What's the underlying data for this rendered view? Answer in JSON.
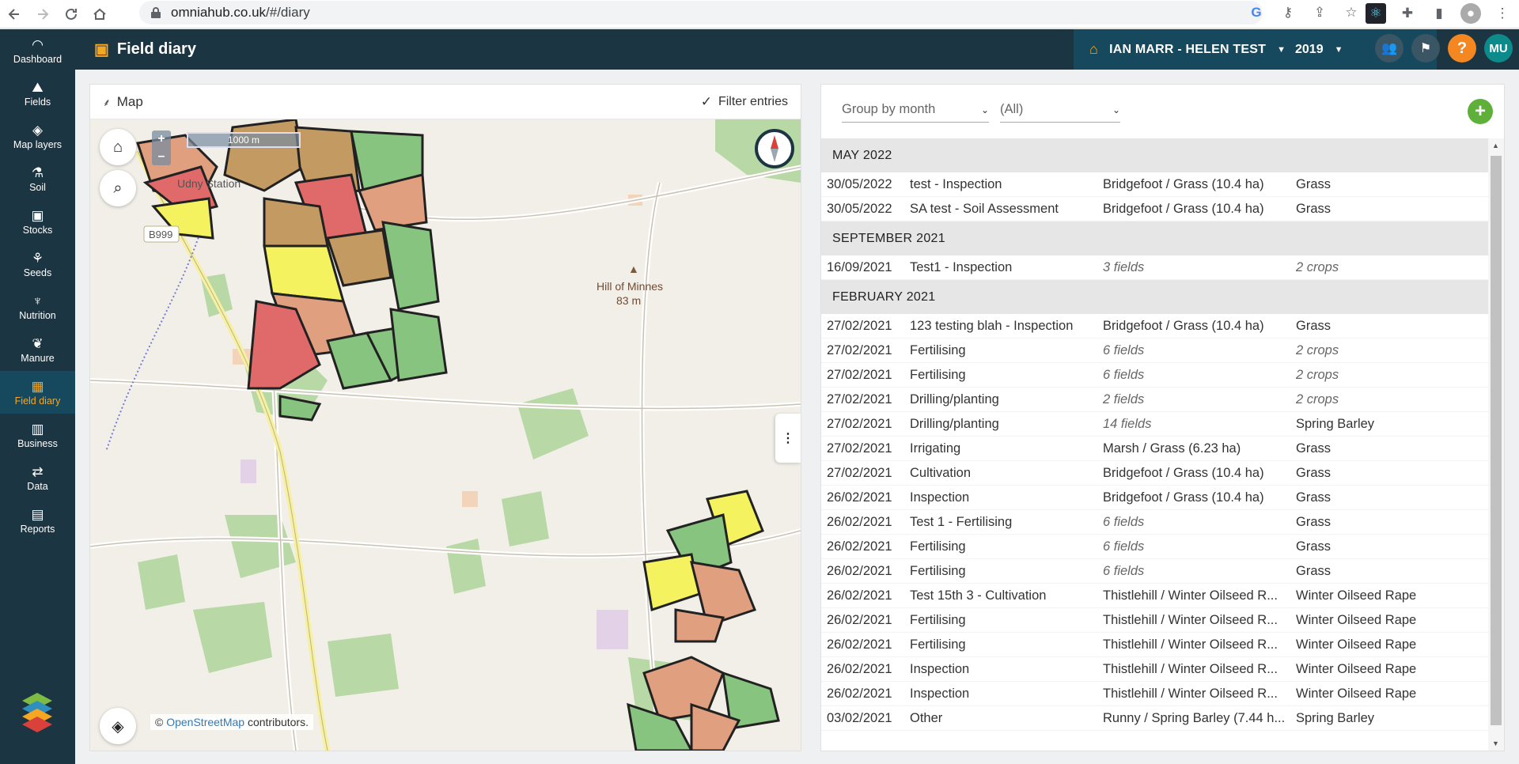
{
  "browser": {
    "url_host": "omniahub.co.uk",
    "url_path": "/#/diary"
  },
  "sidebar": {
    "items": [
      {
        "label": "Dashboard",
        "icon": "dashboard-icon"
      },
      {
        "label": "Fields",
        "icon": "fields-icon"
      },
      {
        "label": "Map layers",
        "icon": "layers-icon"
      },
      {
        "label": "Soil",
        "icon": "soil-icon"
      },
      {
        "label": "Stocks",
        "icon": "stocks-icon"
      },
      {
        "label": "Seeds",
        "icon": "seeds-icon"
      },
      {
        "label": "Nutrition",
        "icon": "nutrition-icon"
      },
      {
        "label": "Manure",
        "icon": "manure-icon"
      },
      {
        "label": "Field diary",
        "icon": "calendar-icon",
        "active": true
      },
      {
        "label": "Business",
        "icon": "chart-icon"
      },
      {
        "label": "Data",
        "icon": "transfer-icon"
      },
      {
        "label": "Reports",
        "icon": "reports-icon"
      }
    ]
  },
  "header": {
    "title": "Field diary",
    "farm": "IAN MARR - HELEN TEST",
    "year": "2019",
    "help": "?",
    "user_initials": "MU"
  },
  "map": {
    "title": "Map",
    "filter_label": "Filter entries",
    "scale_label": "1000 m",
    "zoom_in": "+",
    "zoom_out": "–",
    "labels": {
      "station": "Udny Station",
      "road": "B999",
      "hill_name": "Hill of Minnes",
      "hill_height": "83 m"
    },
    "attribution": {
      "prefix": "©",
      "link": "OpenStreetMap",
      "suffix": "contributors."
    }
  },
  "diary": {
    "group_by": "Group by month",
    "filter": "(All)",
    "add_label": "+",
    "groups": [
      {
        "month": "MAY 2022",
        "rows": [
          {
            "date": "30/05/2022",
            "activity": "test - Inspection",
            "fields": "Bridgefoot / Grass (10.4 ha)",
            "crops": "Grass"
          },
          {
            "date": "30/05/2022",
            "activity": "SA test - Soil Assessment",
            "fields": "Bridgefoot / Grass (10.4 ha)",
            "crops": "Grass"
          }
        ]
      },
      {
        "month": "SEPTEMBER 2021",
        "rows": [
          {
            "date": "16/09/2021",
            "activity": "Test1 - Inspection",
            "fields": "3 fields",
            "fields_italic": true,
            "crops": "2 crops",
            "crops_italic": true
          }
        ]
      },
      {
        "month": "FEBRUARY 2021",
        "rows": [
          {
            "date": "27/02/2021",
            "activity": "123 testing blah - Inspection",
            "fields": "Bridgefoot / Grass (10.4 ha)",
            "crops": "Grass"
          },
          {
            "date": "27/02/2021",
            "activity": "Fertilising",
            "fields": "6 fields",
            "fields_italic": true,
            "crops": "2 crops",
            "crops_italic": true
          },
          {
            "date": "27/02/2021",
            "activity": "Fertilising",
            "fields": "6 fields",
            "fields_italic": true,
            "crops": "2 crops",
            "crops_italic": true
          },
          {
            "date": "27/02/2021",
            "activity": "Drilling/planting",
            "fields": "2 fields",
            "fields_italic": true,
            "crops": "2 crops",
            "crops_italic": true
          },
          {
            "date": "27/02/2021",
            "activity": "Drilling/planting",
            "fields": "14 fields",
            "fields_italic": true,
            "crops": "Spring Barley"
          },
          {
            "date": "27/02/2021",
            "activity": "Irrigating",
            "fields": "Marsh / Grass (6.23 ha)",
            "crops": "Grass"
          },
          {
            "date": "27/02/2021",
            "activity": "Cultivation",
            "fields": "Bridgefoot / Grass (10.4 ha)",
            "crops": "Grass"
          },
          {
            "date": "26/02/2021",
            "activity": "Inspection",
            "fields": "Bridgefoot / Grass (10.4 ha)",
            "crops": "Grass"
          },
          {
            "date": "26/02/2021",
            "activity": "Test 1 - Fertilising",
            "fields": "6 fields",
            "fields_italic": true,
            "crops": "Grass"
          },
          {
            "date": "26/02/2021",
            "activity": "Fertilising",
            "fields": "6 fields",
            "fields_italic": true,
            "crops": "Grass"
          },
          {
            "date": "26/02/2021",
            "activity": "Fertilising",
            "fields": "6 fields",
            "fields_italic": true,
            "crops": "Grass"
          },
          {
            "date": "26/02/2021",
            "activity": "Test 15th 3 - Cultivation",
            "fields": "Thistlehill / Winter Oilseed R...",
            "crops": "Winter Oilseed Rape"
          },
          {
            "date": "26/02/2021",
            "activity": "Fertilising",
            "fields": "Thistlehill / Winter Oilseed R...",
            "crops": "Winter Oilseed Rape"
          },
          {
            "date": "26/02/2021",
            "activity": "Fertilising",
            "fields": "Thistlehill / Winter Oilseed R...",
            "crops": "Winter Oilseed Rape"
          },
          {
            "date": "26/02/2021",
            "activity": "Inspection",
            "fields": "Thistlehill / Winter Oilseed R...",
            "crops": "Winter Oilseed Rape"
          },
          {
            "date": "26/02/2021",
            "activity": "Inspection",
            "fields": "Thistlehill / Winter Oilseed R...",
            "crops": "Winter Oilseed Rape"
          },
          {
            "date": "03/02/2021",
            "activity": "Other",
            "fields": "Runny / Spring Barley (7.44 h...",
            "crops": "Spring Barley"
          }
        ]
      }
    ]
  },
  "colors": {
    "nav_bg": "#1c3542",
    "nav_active": "#16495e",
    "accent": "#f5a623",
    "add_green": "#5fb03a"
  }
}
